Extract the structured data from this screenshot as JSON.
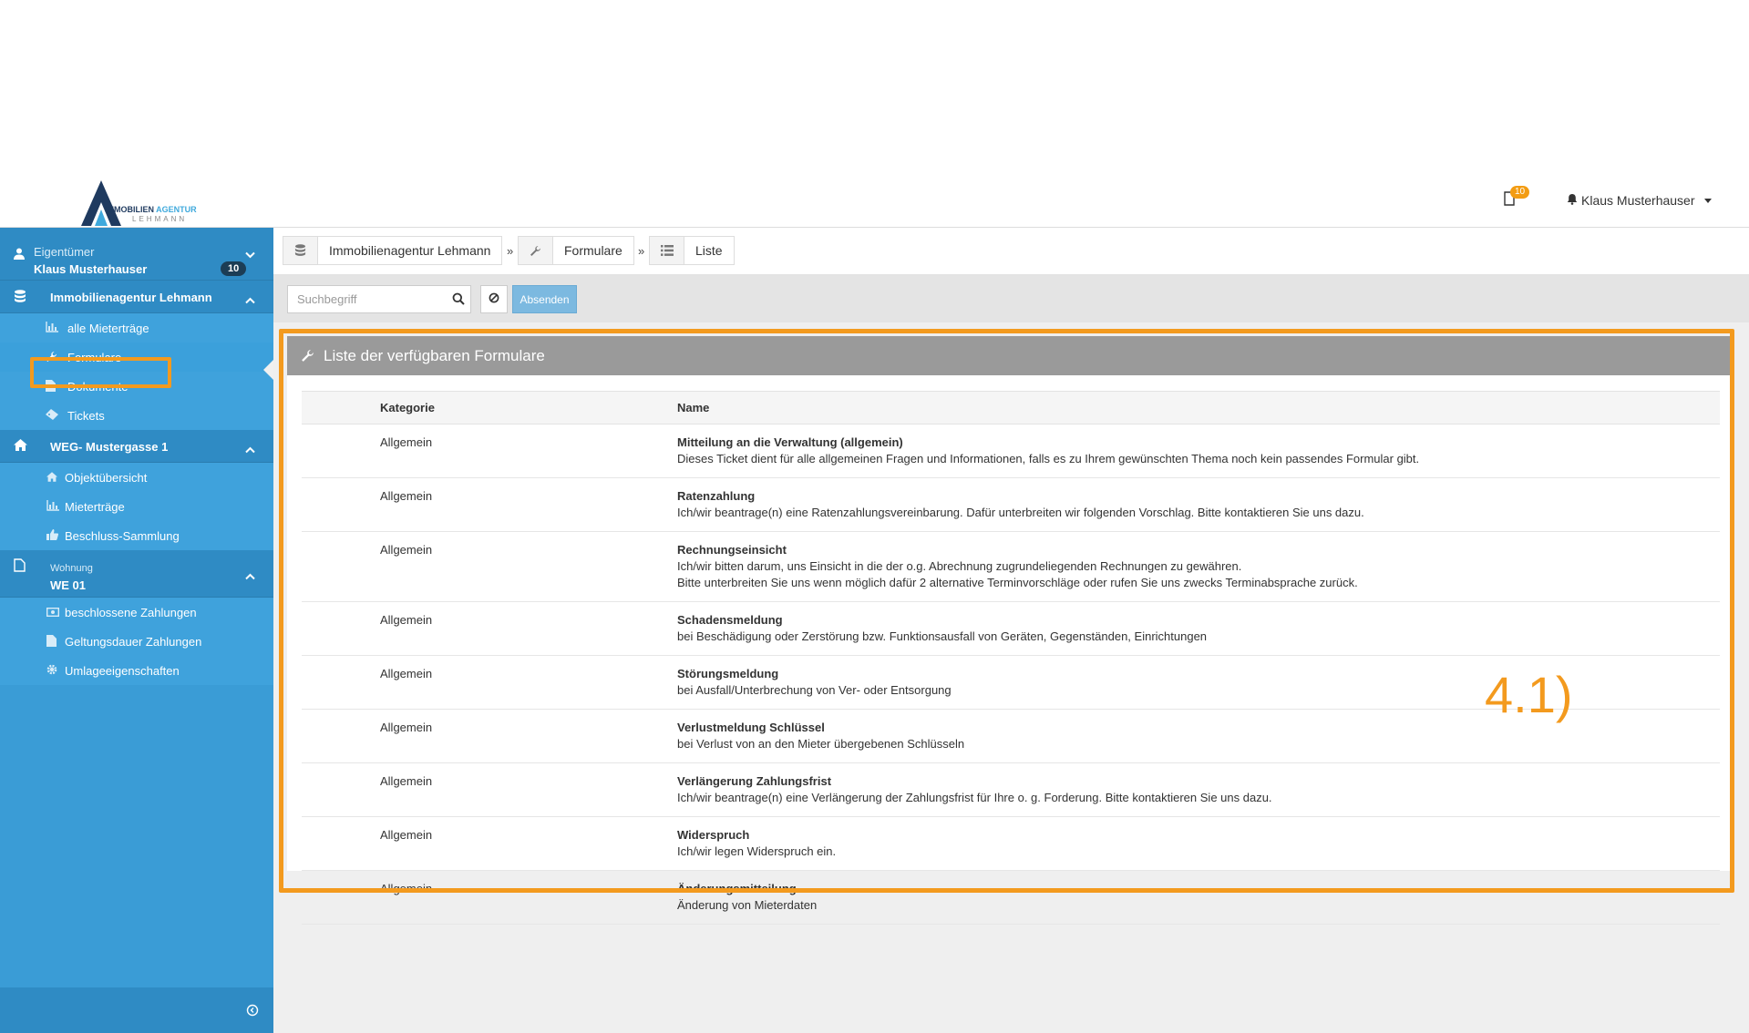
{
  "header": {
    "logo_line1_a": "IMMOBILIEN",
    "logo_line1_b": "AGENTUR",
    "logo_line2": "LEHMANN",
    "notification_count": "10",
    "user_name": "Klaus Musterhauser"
  },
  "sidebar": {
    "user": {
      "role": "Eigentümer",
      "name": "Klaus Musterhauser",
      "badge": "10"
    },
    "group1": {
      "label": "Immobilienagentur Lehmann",
      "items": [
        {
          "label": "alle Mieterträge",
          "icon": "bar-chart-icon"
        },
        {
          "label": "Formulare",
          "icon": "wrench-icon"
        },
        {
          "label": "Dokumente",
          "icon": "file-icon"
        },
        {
          "label": "Tickets",
          "icon": "ticket-icon"
        }
      ]
    },
    "group2": {
      "label": "WEG- Mustergasse 1",
      "items": [
        {
          "label": "Objektübersicht",
          "icon": "home-icon"
        },
        {
          "label": "Mieterträge",
          "icon": "bar-chart-icon"
        },
        {
          "label": "Beschluss-Sammlung",
          "icon": "thumbs-up-icon"
        }
      ]
    },
    "group3": {
      "small": "Wohnung",
      "label": "WE 01",
      "items": [
        {
          "label": "beschlossene Zahlungen",
          "icon": "money-icon"
        },
        {
          "label": "Geltungsdauer Zahlungen",
          "icon": "file-icon"
        },
        {
          "label": "Umlageeigenschaften",
          "icon": "gear-icon"
        }
      ]
    }
  },
  "breadcrumb": {
    "items": [
      "Immobilienagentur Lehmann",
      "Formulare",
      "Liste"
    ],
    "separator": "»"
  },
  "toolbar": {
    "search_placeholder": "Suchbegriff",
    "submit_label": "Absenden"
  },
  "panel": {
    "title": "Liste der verfügbaren Formulare",
    "columns": [
      "Kategorie",
      "Name"
    ],
    "rows": [
      {
        "category": "Allgemein",
        "name": "Mitteilung an die Verwaltung (allgemein)",
        "description": "Dieses Ticket dient für alle allgemeinen Fragen und Informationen, falls es zu Ihrem gewünschten Thema noch kein passendes Formular gibt."
      },
      {
        "category": "Allgemein",
        "name": "Ratenzahlung",
        "description": "Ich/wir beantrage(n) eine Ratenzahlungsvereinbarung. Dafür unterbreiten wir folgenden Vorschlag. Bitte kontaktieren Sie uns dazu."
      },
      {
        "category": "Allgemein",
        "name": "Rechnungseinsicht",
        "description": "Ich/wir bitten darum, uns Einsicht in die der o.g. Abrechnung zugrundeliegenden Rechnungen zu gewähren.\nBitte unterbreiten Sie uns wenn möglich dafür 2 alternative Terminvorschläge oder rufen Sie uns zwecks Terminabsprache zurück."
      },
      {
        "category": "Allgemein",
        "name": "Schadensmeldung",
        "description": "bei Beschädigung oder Zerstörung bzw. Funktionsausfall von Geräten, Gegenständen, Einrichtungen"
      },
      {
        "category": "Allgemein",
        "name": "Störungsmeldung",
        "description": "bei Ausfall/Unterbrechung von Ver- oder Entsorgung"
      },
      {
        "category": "Allgemein",
        "name": "Verlustmeldung Schlüssel",
        "description": "bei Verlust von an den Mieter übergebenen Schlüsseln"
      },
      {
        "category": "Allgemein",
        "name": "Verlängerung Zahlungsfrist",
        "description": "Ich/wir beantrage(n) eine Verlängerung der Zahlungsfrist für Ihre o. g. Forderung. Bitte kontaktieren Sie uns dazu."
      },
      {
        "category": "Allgemein",
        "name": "Widerspruch",
        "description": "Ich/wir legen Widerspruch ein."
      },
      {
        "category": "Allgemein",
        "name": "Änderungsmitteilung",
        "description": "Änderung von Mieterdaten"
      }
    ]
  },
  "annotation": "4.1)",
  "colors": {
    "accent_orange": "#f39a1e",
    "sidebar_blue": "#3a9cd6",
    "panel_header_gray": "#9a9a9a"
  }
}
